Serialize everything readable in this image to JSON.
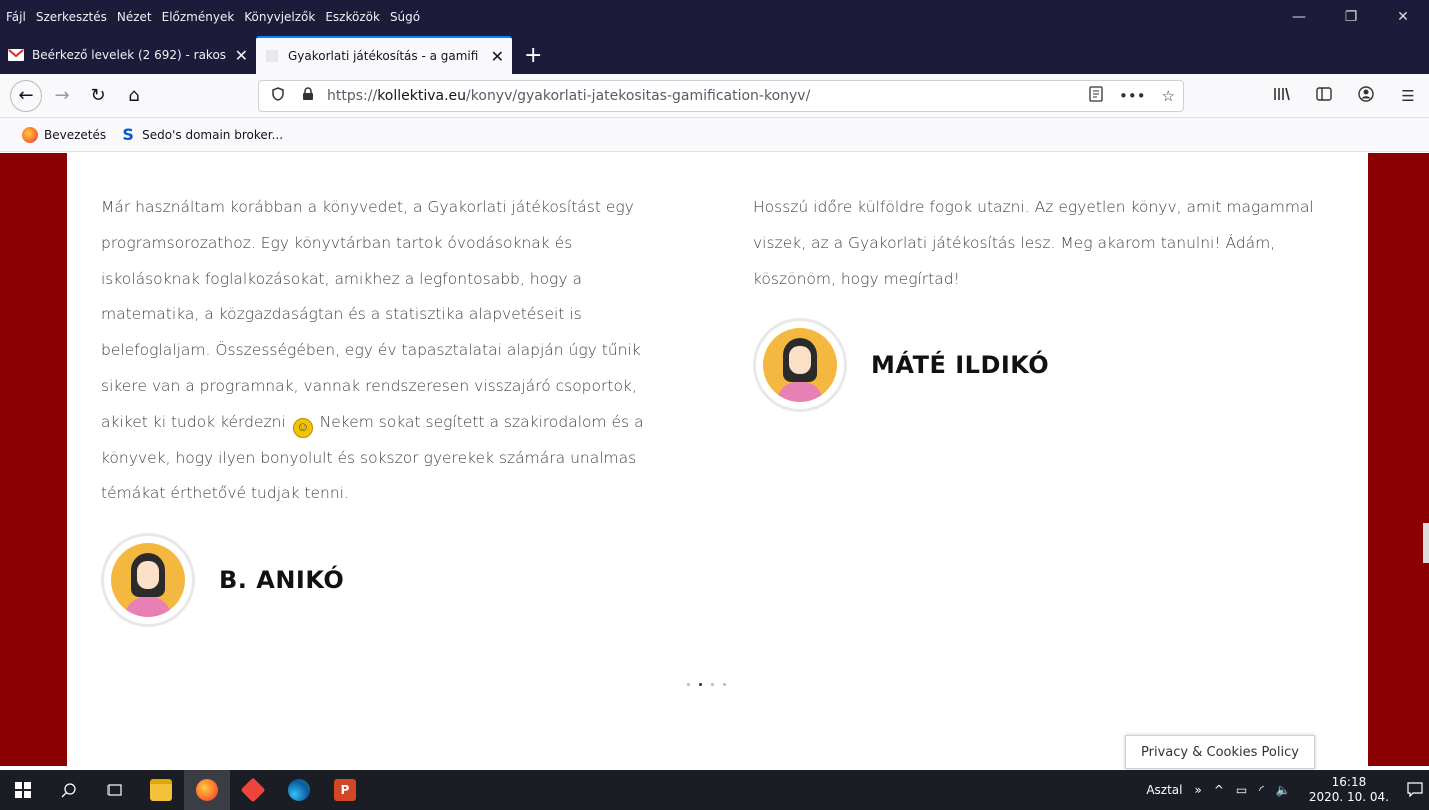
{
  "menu": [
    "Fájl",
    "Szerkesztés",
    "Nézet",
    "Előzmények",
    "Könyvjelzők",
    "Eszközök",
    "Súgó"
  ],
  "window_controls": {
    "minimize": "—",
    "restore": "❐",
    "close": "✕"
  },
  "tabs": [
    {
      "title": "Beérkező levelek (2 692) - rakos",
      "close": "✕",
      "favicon": "gmail-icon"
    },
    {
      "title": "Gyakorlati játékosítás - a gamifi",
      "close": "✕",
      "favicon": "page-icon"
    }
  ],
  "new_tab": "+",
  "nav": {
    "back": "←",
    "forward": "→",
    "reload": "↻",
    "home": "⌂"
  },
  "url": {
    "prefix": "https://",
    "domain": "kollektiva.eu",
    "path": "/konyv/gyakorlati-jatekositas-gamification-konyv/"
  },
  "bookmarks": [
    {
      "label": "Bevezetés",
      "icon": "firefox-icon"
    },
    {
      "label": "Sedo's domain broker...",
      "icon": "sedo-icon",
      "glyph": "S"
    }
  ],
  "testimonials": [
    {
      "text": "Már használtam korábban a könyvedet, a Gyakorlati játékosítást egy programsorozathoz. Egy könyvtárban tartok óvodásoknak és iskolásoknak foglalkozásokat, amikhez a legfontosabb, hogy a matematika, a közgazdaságtan és a statisztika alapvetéseit is belefoglaljam. Összességében, egy év tapasztalatai alapján úgy tűnik sikere van a programnak, vannak rendszeresen visszajáró csoportok, akiket ki tudok kérdezni",
      "text_after": "Nekem sokat segített a szakirodalom és a könyvek, hogy ilyen bonyolult és sokszor gyerekek számára unalmas témákat érthetővé tudjak tenni.",
      "author": "B. ANIKÓ"
    },
    {
      "text": "Hosszú időre külföldre fogok utazni. Az egyetlen könyv, amit magammal viszek, az a Gyakorlati játékosítás lesz. Meg akarom tanulni! Ádám, köszönöm, hogy megírtad!",
      "author": "MÁTÉ ILDIKÓ"
    }
  ],
  "privacy_label": "Privacy & Cookies Policy",
  "taskbar": {
    "tray_label": "Asztal",
    "tray_chevron": "»",
    "time": "16:18",
    "date": "2020. 10. 04."
  },
  "colors": {
    "page_bg": "#8b0000",
    "tab_accent": "#0a84ff",
    "chrome_dark": "#1c1b3a"
  }
}
